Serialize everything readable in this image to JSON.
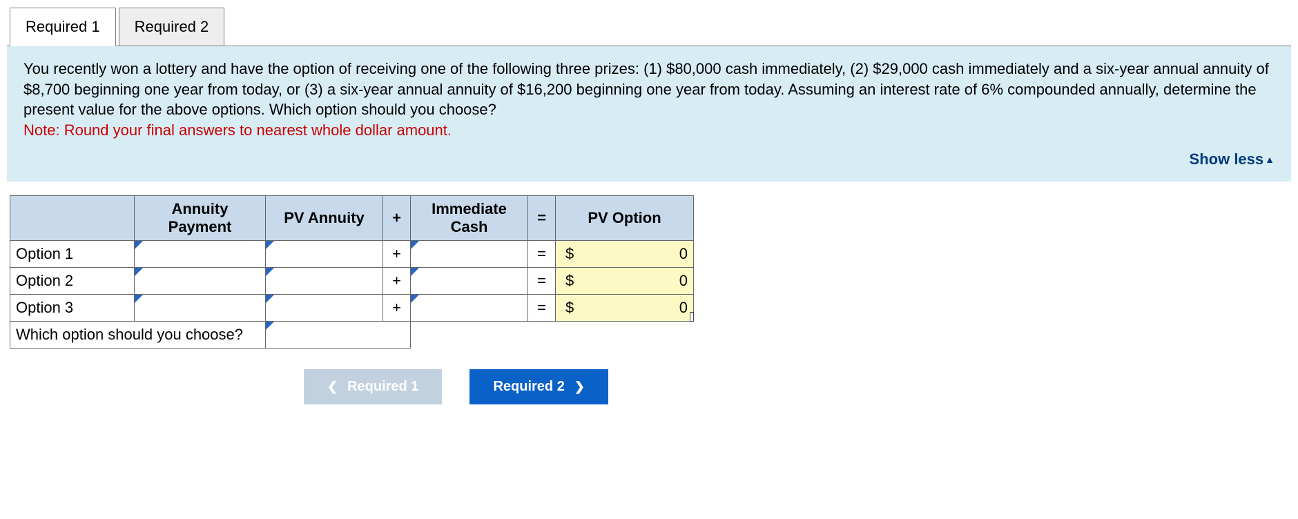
{
  "tabs": {
    "t1": "Required 1",
    "t2": "Required 2"
  },
  "prompt": {
    "body": "You recently won a lottery and have the option of receiving one of the following three prizes: (1) $80,000 cash immediately, (2) $29,000 cash immediately and a six-year annual annuity of $8,700 beginning one year from today, or (3) a six-year annual annuity of $16,200 beginning one year from today. Assuming an interest rate of 6% compounded annually, determine the present value for the above options. Which option should you choose?",
    "note": "Note: Round your final answers to nearest whole dollar amount.",
    "toggle": "Show less"
  },
  "headers": {
    "annuity": "Annuity Payment",
    "pvann": "PV Annuity",
    "plus": "+",
    "cash": "Immediate Cash",
    "eq": "=",
    "pvopt": "PV Option"
  },
  "rows": {
    "r1": {
      "label": "Option 1",
      "plus": "+",
      "eq": "=",
      "dollar": "$",
      "val": "0"
    },
    "r2": {
      "label": "Option 2",
      "plus": "+",
      "eq": "=",
      "dollar": "$",
      "val": "0"
    },
    "r3": {
      "label": "Option 3",
      "plus": "+",
      "eq": "=",
      "dollar": "$",
      "val": "0"
    },
    "choose": "Which option should you choose?"
  },
  "nav": {
    "prev": "Required 1",
    "next": "Required 2"
  }
}
